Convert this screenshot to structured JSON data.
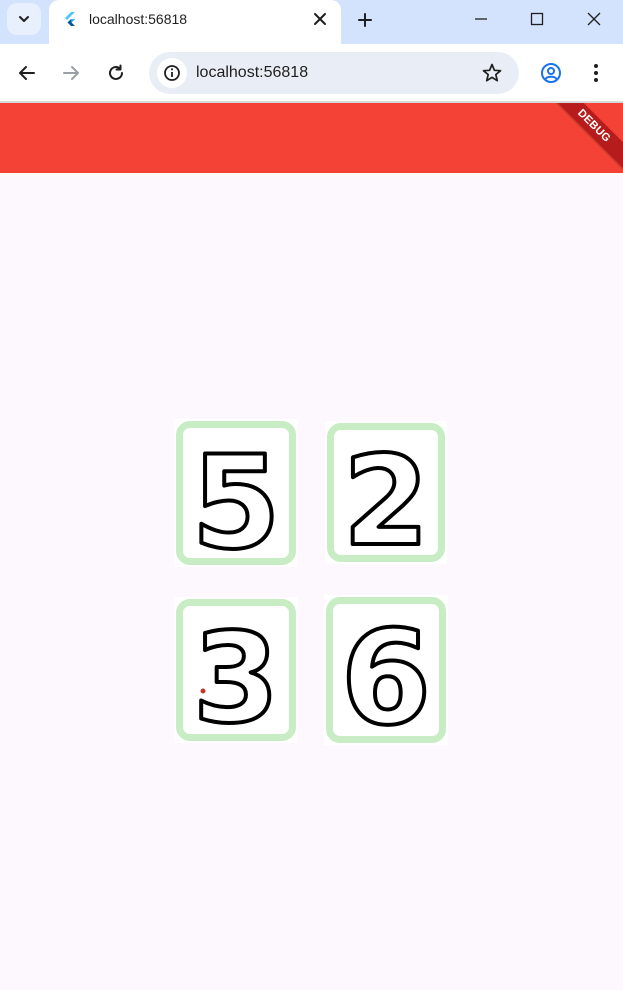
{
  "browser": {
    "tab_title": "localhost:56818",
    "url": "localhost:56818",
    "icons": {
      "tab_search": "chevron-down-icon",
      "favicon": "flutter-logo-icon",
      "tab_close": "close-icon",
      "new_tab": "plus-icon",
      "minimize": "minimize-icon",
      "maximize": "maximize-icon",
      "close_window": "close-icon",
      "back": "arrow-left-icon",
      "forward": "arrow-right-icon",
      "reload": "reload-icon",
      "site_info": "info-icon",
      "bookmark": "star-icon",
      "profile": "profile-icon",
      "menu": "kebab-menu-icon"
    }
  },
  "app": {
    "appbar_color": "#f44336",
    "debug_banner": "DEBUG",
    "background": "#fdf7fe",
    "card_border_color": "#c8ecc3",
    "cards": [
      {
        "digit": "5"
      },
      {
        "digit": "2"
      },
      {
        "digit": "3"
      },
      {
        "digit": "6"
      }
    ]
  }
}
